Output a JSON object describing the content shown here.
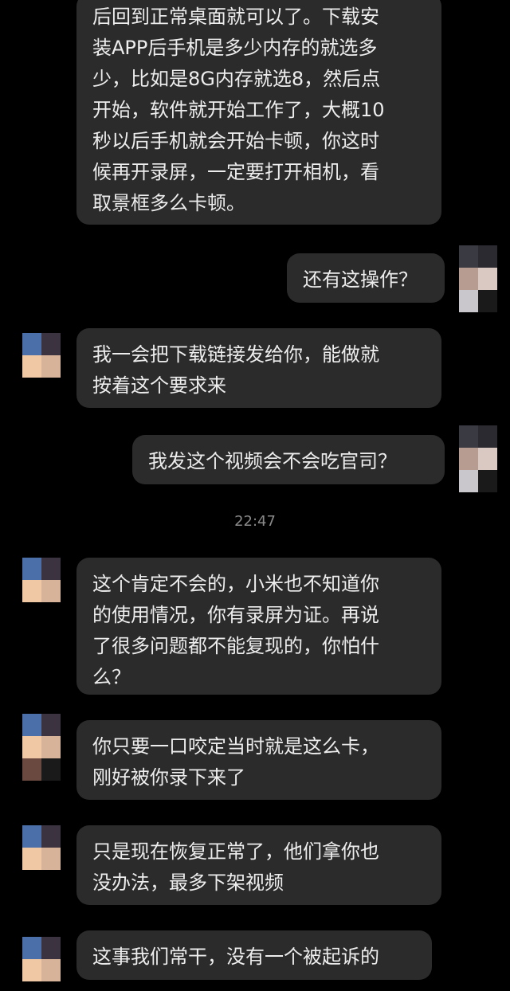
{
  "messages": [
    {
      "side": "left",
      "lines": [
        "后回到正常桌面就可以了。下载安",
        "装APP后手机是多少内存的就选多",
        "少，比如是8G内存就选8，然后点",
        "开始，软件就开始工作了，大概10",
        "秒以后手机就会开始卡顿，你这时",
        "候再开录屏，一定要打开相机，看",
        "取景框多么卡顿。"
      ]
    },
    {
      "side": "right",
      "lines": [
        "还有这操作？"
      ]
    },
    {
      "side": "left",
      "lines": [
        "我一会把下载链接发给你，能做就",
        "按着这个要求来"
      ]
    },
    {
      "side": "right",
      "lines": [
        "我发这个视频会不会吃官司？"
      ]
    },
    {
      "side": "left",
      "lines": [
        "这个肯定不会的，小米也不知道你",
        "的使用情况，你有录屏为证。再说",
        "了很多问题都不能复现的，你怕什",
        "么？"
      ]
    },
    {
      "side": "left",
      "lines": [
        "你只要一口咬定当时就是这么卡，",
        "刚好被你录下来了"
      ]
    },
    {
      "side": "left",
      "lines": [
        "只是现在恢复正常了，他们拿你也",
        "没办法，最多下架视频"
      ]
    },
    {
      "side": "left",
      "lines": [
        "这事我们常干，没有一个被起诉的"
      ]
    }
  ],
  "timestamp": "22:47",
  "colors": {
    "background": "#000000",
    "bubble": "#2b2b2b",
    "text": "#ededed",
    "timestamp": "#8a8a8a"
  }
}
